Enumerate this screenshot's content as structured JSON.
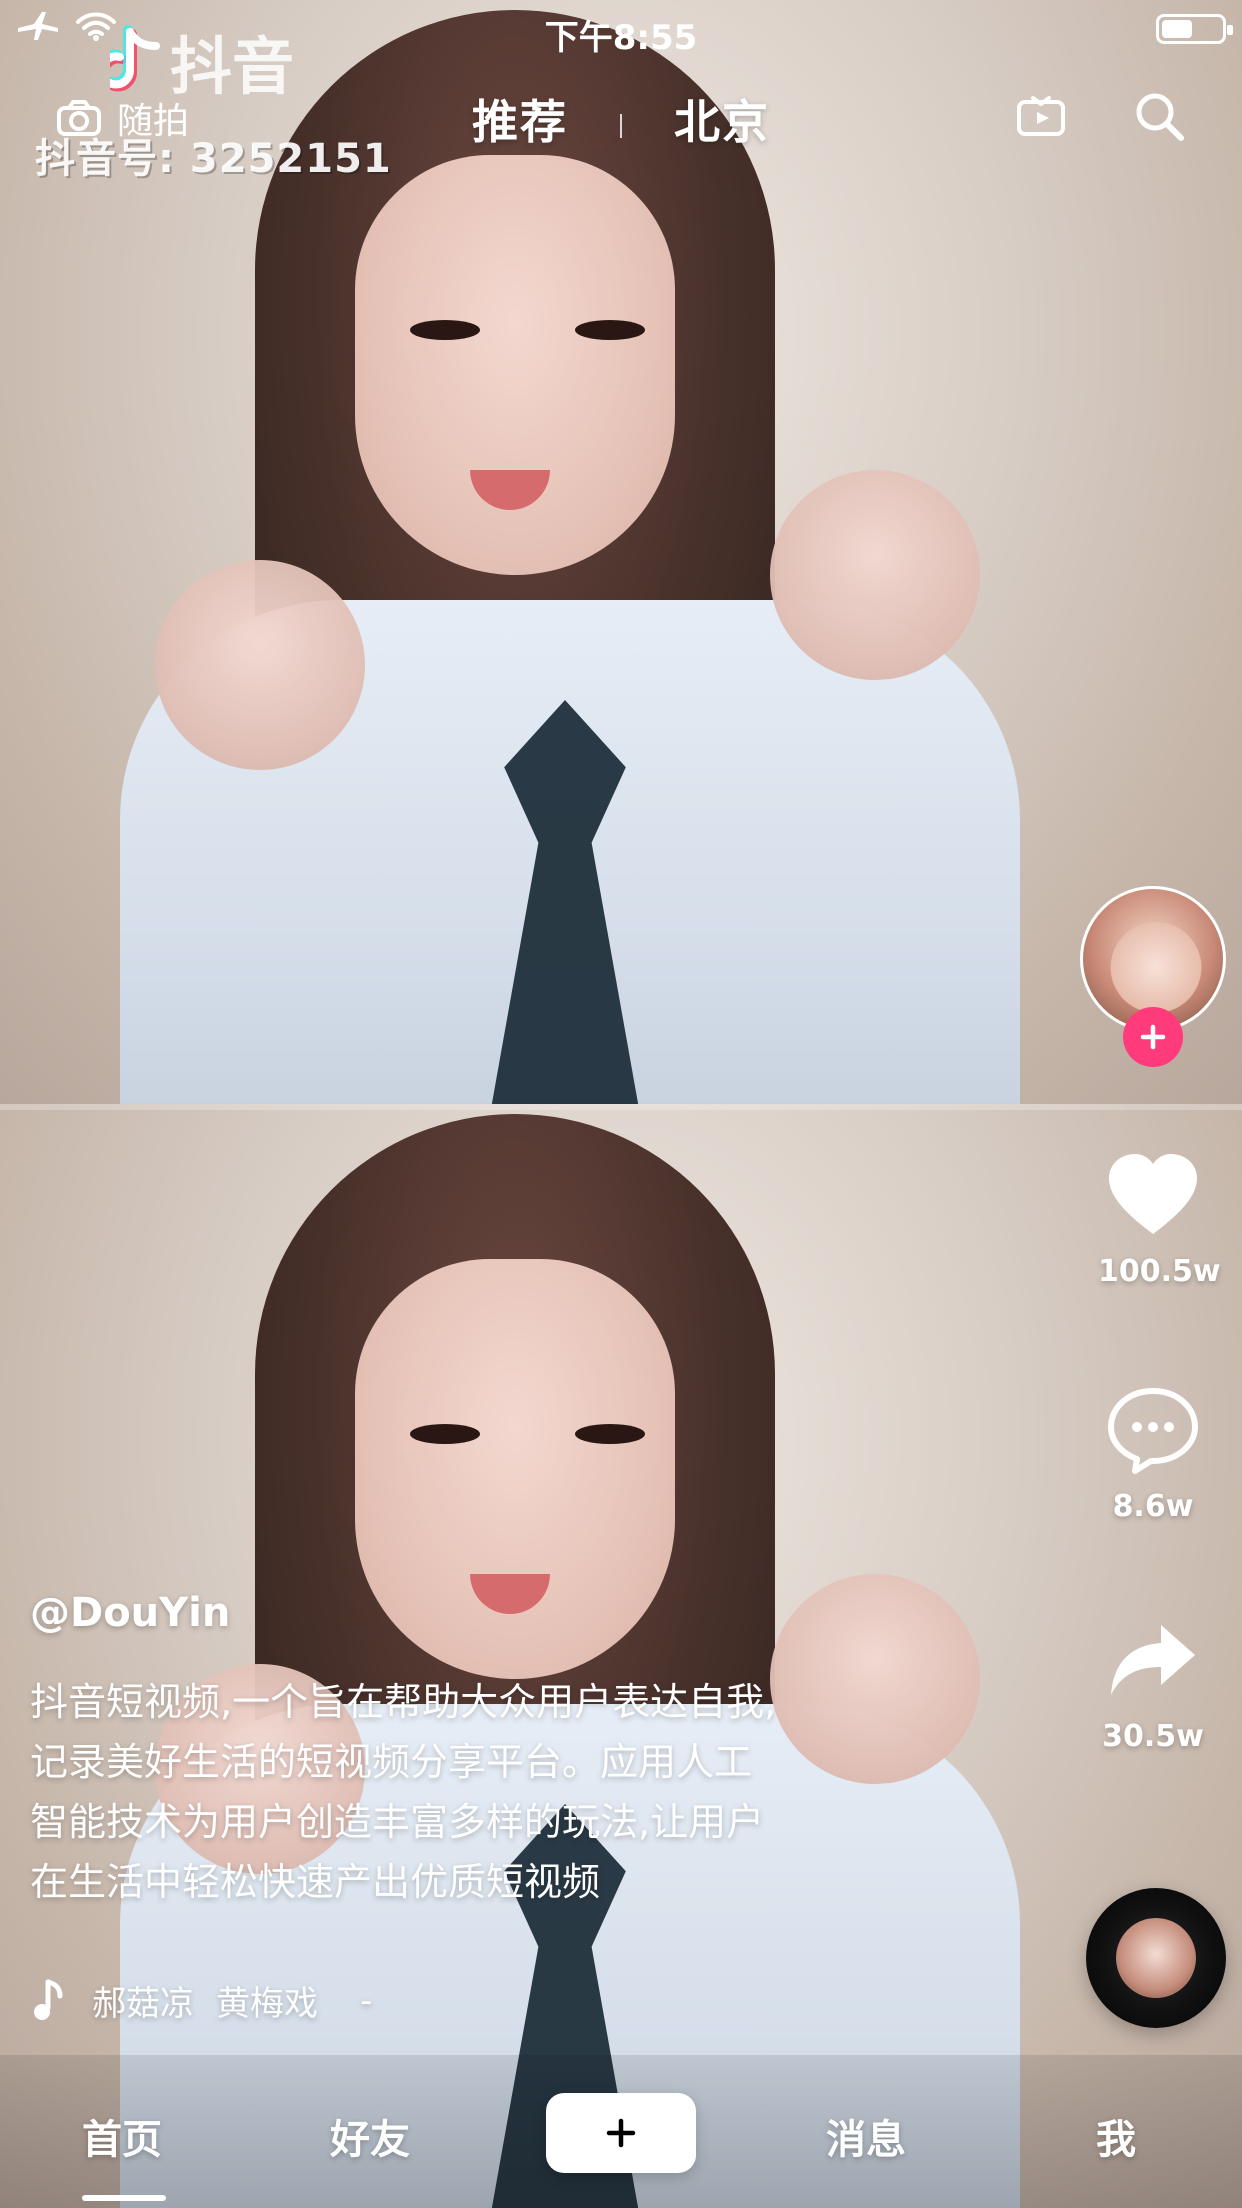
{
  "status_bar": {
    "time": "下午8:55"
  },
  "watermark": {
    "brand": "抖音",
    "id": "抖音号: 3252151"
  },
  "top_nav": {
    "left_label": "随拍",
    "tabs": [
      "推荐",
      "北京"
    ]
  },
  "rail": {
    "likes": "100.5w",
    "comments": "8.6w",
    "shares": "30.5w"
  },
  "post": {
    "handle": "@DouYin",
    "description": "抖音短视频,一个旨在帮助大众用户表达自我,\n记录美好生活的短视频分享平台。应用人工\n智能技术为用户创造丰富多样的玩法,让用户\n在生活中轻松快速产出优质短视频",
    "music_artist": "郝菇凉",
    "music_title": "黄梅戏",
    "music_suffix": "-"
  },
  "tabbar": {
    "home": "首页",
    "friends": "好友",
    "messages": "消息",
    "me": "我"
  },
  "colors": {
    "follow_accent": "#ff3b7b"
  }
}
